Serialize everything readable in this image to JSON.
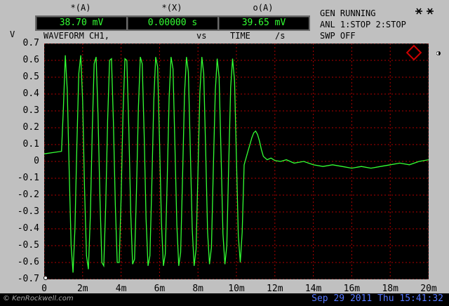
{
  "header": {
    "labels": [
      "*(A)",
      "*(X)",
      "o(A)"
    ],
    "readouts": [
      "38.70 mV",
      "0.00000 s",
      "39.65 mV"
    ],
    "units": [
      "vs",
      "/s"
    ],
    "waveform_label": "WAVEFORM CH1,",
    "time_label": "TIME",
    "v_label": "V",
    "icon_text": "ꕃꕃ"
  },
  "status": {
    "line1": "GEN RUNNING",
    "line2": "ANL 1:STOP 2:STOP",
    "line3": "SWP OFF"
  },
  "footer": {
    "datetime": "Sep 29 2011 Thu 15:41:32",
    "credit": "© KenRockwell.com"
  },
  "colors": {
    "trace": "#33ff33",
    "grid": "#b00000",
    "readout_text": "#33ff33",
    "datetime": "#5577ff",
    "logo": "#cc0000"
  },
  "chart_data": {
    "type": "line",
    "title": "",
    "xlabel": "",
    "ylabel": "V",
    "xlim": [
      0,
      0.02
    ],
    "ylim": [
      -0.7,
      0.7
    ],
    "x_ticks": [
      "0",
      "2m",
      "4m",
      "6m",
      "8m",
      "10m",
      "12m",
      "14m",
      "16m",
      "18m",
      "20m"
    ],
    "y_ticks": [
      "0.7",
      "0.6",
      "0.5",
      "0.4",
      "0.3",
      "0.2",
      "0.1",
      "0",
      "-0.1",
      "-0.2",
      "-0.3",
      "-0.4",
      "-0.5",
      "-0.6",
      "-0.7"
    ],
    "grid": true,
    "series": [
      {
        "x": [
          0,
          0.0009,
          0.001,
          0.0011,
          0.0012,
          0.0013,
          0.0014,
          0.0015,
          0.0016,
          0.0017,
          0.0018,
          0.0019,
          0.002,
          0.0021,
          0.0022,
          0.0023,
          0.0024,
          0.0025,
          0.0026,
          0.0027,
          0.0028,
          0.0029,
          0.003,
          0.0031,
          0.0032,
          0.0033,
          0.0034,
          0.0035,
          0.0036,
          0.0037,
          0.0038,
          0.0039,
          0.004,
          0.0041,
          0.0042,
          0.0043,
          0.0044,
          0.0045,
          0.0046,
          0.0047,
          0.0048,
          0.0049,
          0.005,
          0.0051,
          0.0052,
          0.0053,
          0.0054,
          0.0055,
          0.0056,
          0.0057,
          0.0058,
          0.0059,
          0.006,
          0.0061,
          0.0062,
          0.0063,
          0.0064,
          0.0065,
          0.0066,
          0.0067,
          0.0068,
          0.0069,
          0.007,
          0.0071,
          0.0072,
          0.0073,
          0.0074,
          0.0075,
          0.0076,
          0.0077,
          0.0078,
          0.0079,
          0.008,
          0.0081,
          0.0082,
          0.0083,
          0.0084,
          0.0085,
          0.0086,
          0.0087,
          0.0088,
          0.0089,
          0.009,
          0.0091,
          0.0092,
          0.0093,
          0.0094,
          0.0095,
          0.0096,
          0.0097,
          0.0098,
          0.0099,
          0.01,
          0.0101,
          0.0102,
          0.0103,
          0.0104,
          0.0105,
          0.0106,
          0.0107,
          0.0108,
          0.0109,
          0.011,
          0.0111,
          0.0112,
          0.0113,
          0.0114,
          0.0116,
          0.0118,
          0.012,
          0.0123,
          0.0126,
          0.013,
          0.0135,
          0.014,
          0.0145,
          0.015,
          0.0155,
          0.016,
          0.0165,
          0.017,
          0.0175,
          0.018,
          0.0185,
          0.019,
          0.0195,
          0.02
        ],
        "y": [
          0.045,
          0.06,
          0.32,
          0.63,
          0.42,
          -0.05,
          -0.5,
          -0.66,
          -0.4,
          0.1,
          0.52,
          0.63,
          0.36,
          -0.16,
          -0.56,
          -0.64,
          -0.32,
          0.18,
          0.58,
          0.62,
          0.28,
          -0.22,
          -0.6,
          -0.62,
          -0.26,
          0.24,
          0.6,
          0.61,
          0.24,
          -0.26,
          -0.6,
          -0.6,
          -0.22,
          0.28,
          0.61,
          0.6,
          0.2,
          -0.3,
          -0.61,
          -0.58,
          -0.18,
          0.32,
          0.62,
          0.58,
          0.16,
          -0.34,
          -0.62,
          -0.56,
          -0.14,
          0.36,
          0.62,
          0.56,
          0.12,
          -0.36,
          -0.62,
          -0.55,
          -0.1,
          0.38,
          0.62,
          0.55,
          0.1,
          -0.38,
          -0.62,
          -0.54,
          -0.08,
          0.4,
          0.62,
          0.53,
          0.08,
          -0.4,
          -0.62,
          -0.52,
          -0.06,
          0.41,
          0.62,
          0.52,
          0.06,
          -0.42,
          -0.61,
          -0.51,
          -0.04,
          0.42,
          0.61,
          0.5,
          0.04,
          -0.43,
          -0.61,
          -0.5,
          -0.02,
          0.44,
          0.61,
          0.48,
          0.02,
          -0.44,
          -0.6,
          -0.42,
          -0.02,
          0.02,
          0.06,
          0.1,
          0.14,
          0.17,
          0.18,
          0.16,
          0.12,
          0.07,
          0.03,
          0.01,
          0.02,
          0.005,
          0.0,
          0.01,
          -0.01,
          0.0,
          -0.02,
          -0.03,
          -0.02,
          -0.03,
          -0.04,
          -0.03,
          -0.04,
          -0.03,
          -0.02,
          -0.01,
          -0.02,
          0.0,
          0.01
        ]
      }
    ]
  }
}
